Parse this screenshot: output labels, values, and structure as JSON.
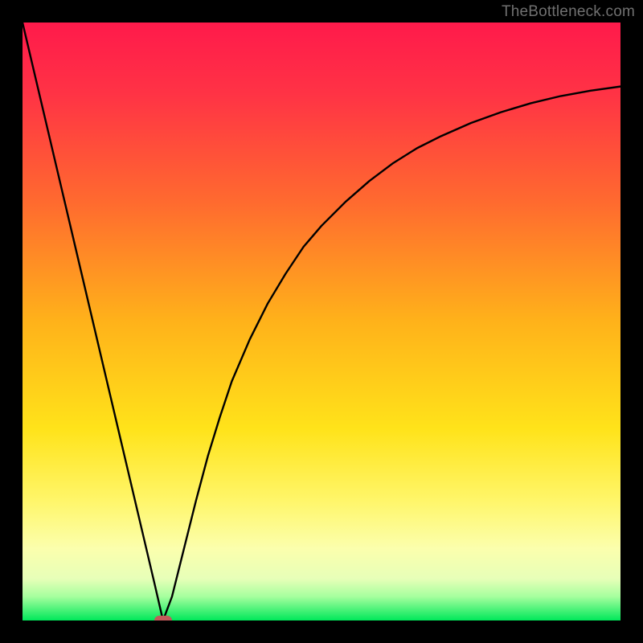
{
  "watermark": "TheBottleneck.com",
  "chart_data": {
    "type": "line",
    "title": "",
    "xlabel": "",
    "ylabel": "",
    "xlim": [
      0,
      100
    ],
    "ylim": [
      0,
      100
    ],
    "grid": false,
    "legend": false,
    "gradient_stops": [
      {
        "pct": 0,
        "color": "#ff1a4b"
      },
      {
        "pct": 12,
        "color": "#ff3345"
      },
      {
        "pct": 30,
        "color": "#ff6a2f"
      },
      {
        "pct": 50,
        "color": "#ffb21a"
      },
      {
        "pct": 68,
        "color": "#ffe31a"
      },
      {
        "pct": 80,
        "color": "#fff66a"
      },
      {
        "pct": 88,
        "color": "#fbffad"
      },
      {
        "pct": 93,
        "color": "#e7ffb8"
      },
      {
        "pct": 96,
        "color": "#a6ff9e"
      },
      {
        "pct": 100,
        "color": "#00e85a"
      }
    ],
    "series": [
      {
        "name": "bottleneck-curve",
        "x": [
          0,
          2,
          4,
          6,
          8,
          10,
          12,
          14,
          16,
          18,
          20,
          22,
          23.5,
          25,
          27,
          29,
          31,
          33,
          35,
          38,
          41,
          44,
          47,
          50,
          54,
          58,
          62,
          66,
          70,
          75,
          80,
          85,
          90,
          95,
          100
        ],
        "y": [
          100,
          91.5,
          83,
          74.5,
          66,
          57.5,
          49,
          40.5,
          32,
          23.5,
          15,
          6.5,
          0,
          4,
          12,
          20,
          27.5,
          34,
          40,
          47,
          53,
          58,
          62.5,
          66,
          70,
          73.5,
          76.5,
          79,
          81,
          83.2,
          85,
          86.5,
          87.7,
          88.6,
          89.3
        ]
      }
    ],
    "marker": {
      "x": 23.5,
      "y": 0
    }
  }
}
